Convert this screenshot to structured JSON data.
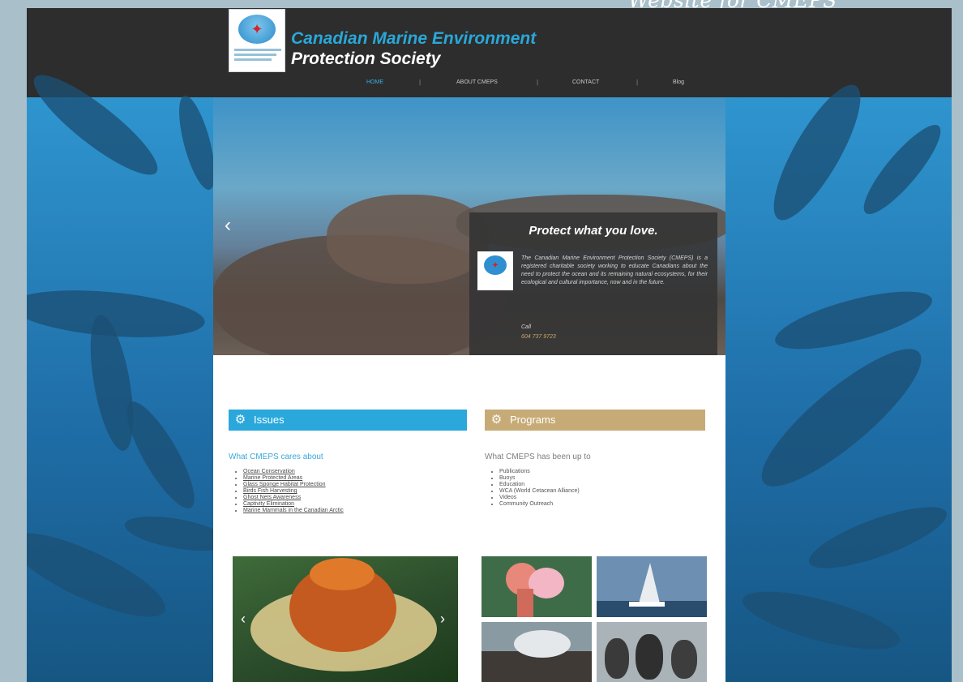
{
  "caption": "Website for CMEPS",
  "header": {
    "brand_line1": "Canadian Marine Environment",
    "brand_line2": "Protection Society",
    "nav": [
      {
        "label": "HOME",
        "active": true
      },
      {
        "label": "ABOUT CMEPS",
        "active": false
      },
      {
        "label": "CONTACT",
        "active": false
      },
      {
        "label": "Blog",
        "active": false
      }
    ],
    "nav_separator": "|"
  },
  "hero": {
    "title": "Protect what you love.",
    "text": "The Canadian Marine Environment Protection Society (CMEPS) is a registered charitable society working to educate Canadians about the need to protect the ocean and its remaining natural ecosystems, for their ecological and cultural importance, now and in the future.",
    "call_label": "Call",
    "phone": "604 737 9723",
    "prev_arrow": "‹"
  },
  "issues": {
    "title": "Issues",
    "subtitle": "What CMEPS cares about",
    "items": [
      "Ocean Conservation",
      "Marine Protected Areas",
      "Glass Sponge Habitat Protection",
      "Birds Fish Harvesting",
      "Ghost Nets Awareness",
      "Captivity Elimination",
      "Marine Mammals in the Canadian Arctic"
    ]
  },
  "programs": {
    "title": "Programs",
    "subtitle": "What CMEPS has been up to",
    "items": [
      "Publications",
      "Buoys",
      "Education",
      "WCA (World Cetacean Alliance)",
      "Videos",
      "Community Outreach"
    ]
  },
  "gallery": {
    "prev_arrow": "‹",
    "next_arrow": "›"
  },
  "colors": {
    "header_bg": "#2d2d2d",
    "brand_blue": "#29a8d9",
    "issues_blue": "#2aa8dc",
    "programs_tan": "#c7ab77",
    "phone_gold": "#c9a86b"
  },
  "icons": {
    "panel": "gear-icon",
    "logo_mark": "maple-leaf-icon"
  }
}
